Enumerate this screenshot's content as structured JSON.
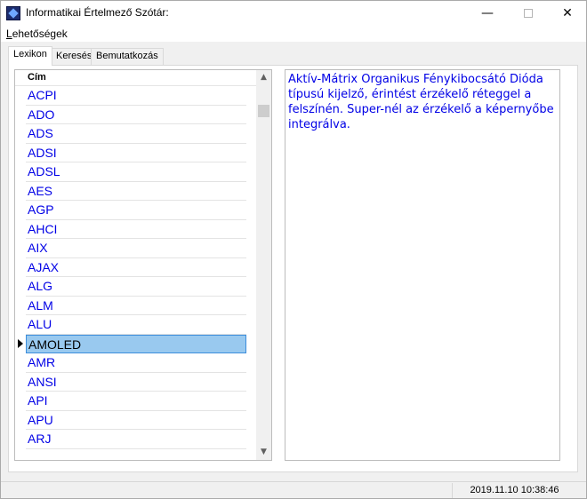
{
  "window": {
    "title": "Informatikai Értelmező Szótár:",
    "minimize_glyph": "—",
    "maximize_glyph": "☐",
    "close_glyph": "✕",
    "icon": "app-icon"
  },
  "menu": {
    "items": [
      {
        "label_first": "L",
        "label_rest": "ehetőségek"
      }
    ]
  },
  "tabs": [
    {
      "label": "Lexikon",
      "active": true
    },
    {
      "label": "Keresés",
      "active": false
    },
    {
      "label": "Bemutatkozás",
      "active": false
    }
  ],
  "list": {
    "column_header": "Cím",
    "items": [
      "ACPI",
      "ADO",
      "ADS",
      "ADSI",
      "ADSL",
      "AES",
      "AGP",
      "AHCI",
      "AIX",
      "AJAX",
      "ALG",
      "ALM",
      "ALU",
      "AMOLED",
      "AMR",
      "ANSI",
      "API",
      "APU",
      "ARJ"
    ],
    "selected": "AMOLED",
    "scroll_up_glyph": "▲",
    "scroll_down_glyph": "▼"
  },
  "description": {
    "text": "Aktív-Mátrix Organikus Fénykibocsátó Dióda típusú kijelző, érintést érzékelő réteggel a felszínén. Super-nél az érzékelő a képernyőbe integrálva."
  },
  "status": {
    "datetime": "2019.11.10 10:38:46"
  },
  "colors": {
    "link_text": "#0000e6",
    "selection": "#99c9ef"
  }
}
